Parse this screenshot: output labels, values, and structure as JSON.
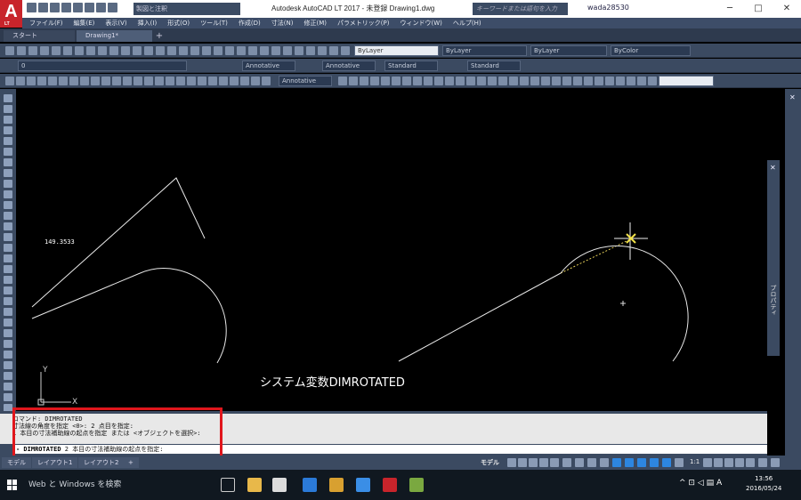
{
  "titlebar": {
    "logo_letter": "A",
    "logo_sub": "LT",
    "workspace": "製図と注釈",
    "title": "Autodesk AutoCAD LT 2017 - 未登録    Drawing1.dwg",
    "search_placeholder": "キーワードまたは語句を入力",
    "user": "wada28530",
    "minimize": "─",
    "maximize": "□",
    "close": "✕"
  },
  "menu": [
    "ファイル(F)",
    "編集(E)",
    "表示(V)",
    "挿入(I)",
    "形式(O)",
    "ツール(T)",
    "作成(D)",
    "寸法(N)",
    "修正(M)",
    "パラメトリック(P)",
    "ウィンドウ(W)",
    "ヘルプ(H)"
  ],
  "tabs": {
    "start": "スタート",
    "drawing": "Drawing1*",
    "add": "+"
  },
  "toolbar": {
    "layer_combo": "ByLayer",
    "linetype_combo": "ByLayer",
    "lineweight_combo": "ByLayer",
    "color_combo": "ByColor",
    "layer_name": "0",
    "text_style": "Annotative",
    "dim_style": "Annotative",
    "table_style": "Standard",
    "mleader_style": "Standard",
    "annotative_combo": "Annotative"
  },
  "canvas": {
    "dim_value": "149.3533",
    "caption": "システム変数DIMROTATED",
    "ucs_y": "Y",
    "ucs_x": "X"
  },
  "properties_panel": {
    "label": "プロパティ",
    "close": "✕"
  },
  "command": {
    "history": [
      "コマンド: DIMROTATED",
      "寸法線の角度を指定 <0>:  2 点目を指定:",
      "1 本目の寸法補助線の起点を指定 または <オブジェクトを選択>:"
    ],
    "prompt_cmd": "- DIMROTATED",
    "prompt_text": " 2 本目の寸法補助線の起点を指定:"
  },
  "status": {
    "tab_model": "モデル",
    "tab_layout1": "レイアウト1",
    "tab_layout2": "レイアウト2",
    "tab_add": "+",
    "model_label": "モデル",
    "scale": "1:1"
  },
  "taskbar": {
    "search": "Web と Windows を検索",
    "ime": "A",
    "time": "13:56",
    "date": "2016/05/24"
  },
  "colors": {
    "accent_red": "#c8242b",
    "highlight_border": "#e0161c",
    "ui_blue": "#3b4a61",
    "canvas_bg": "#000000"
  }
}
